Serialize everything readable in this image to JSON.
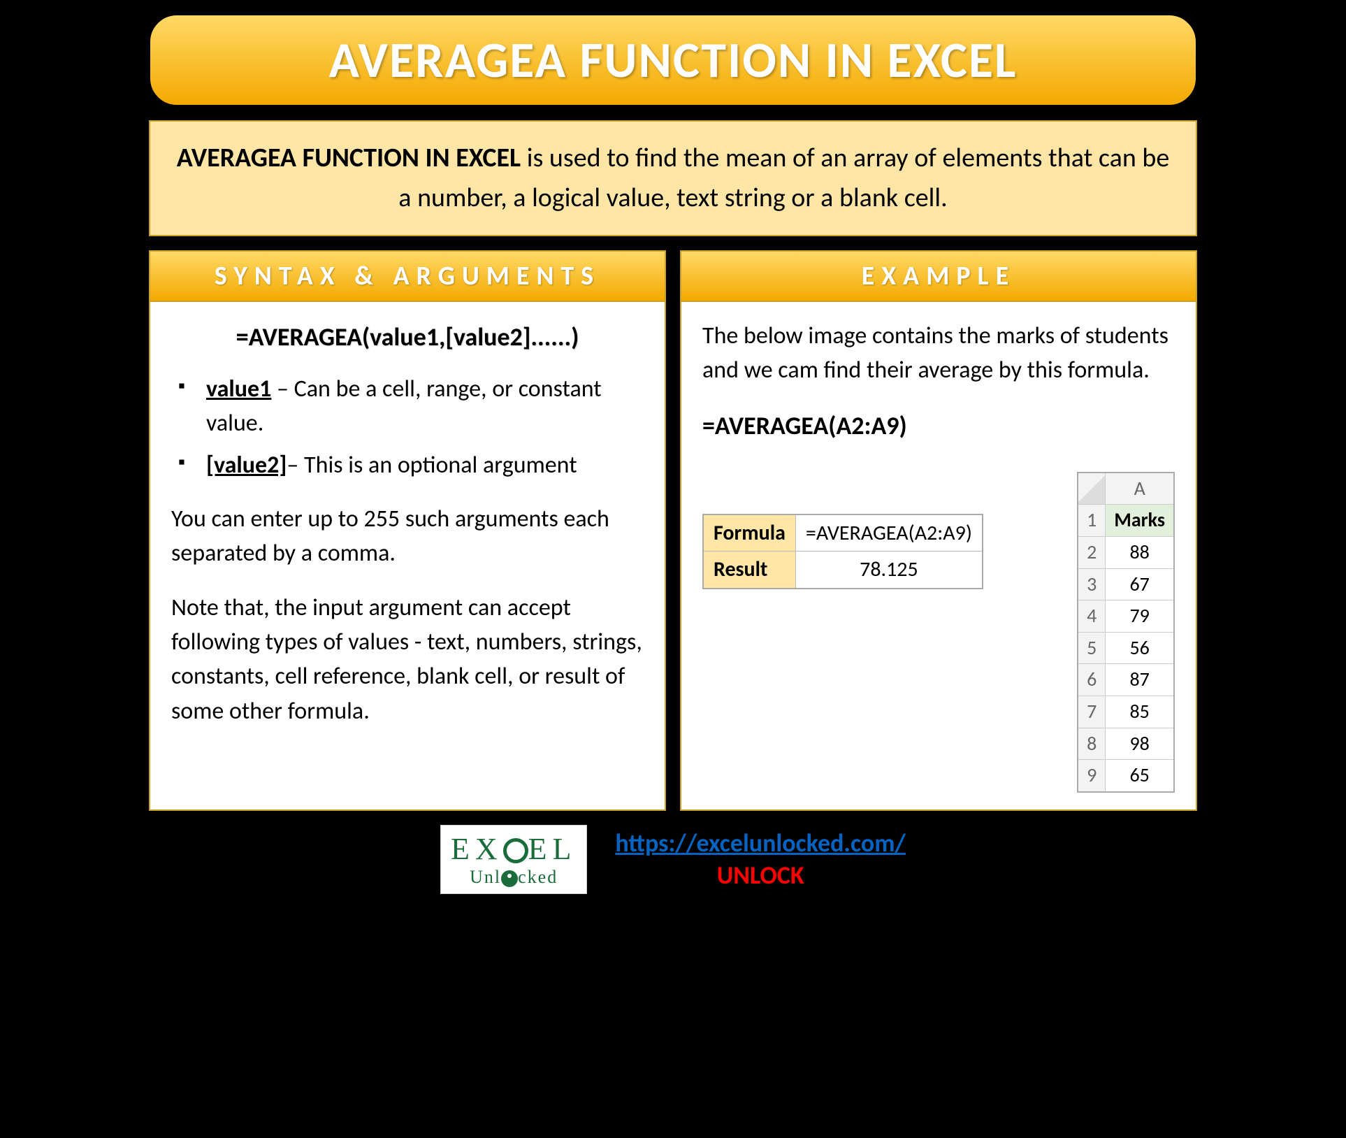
{
  "title": "AVERAGEA FUNCTION IN EXCEL",
  "description": {
    "lead": "AVERAGEA FUNCTION IN EXCEL",
    "rest": " is used to find the mean of an array of elements that can be a number, a logical value, text string or a blank cell."
  },
  "syntax": {
    "header": "SYNTAX & ARGUMENTS",
    "formula": "=AVERAGEA(value1,[value2]......)",
    "args": [
      {
        "name": "value1",
        "desc": " – Can be a cell, range, or constant value."
      },
      {
        "name": "[value2]",
        "desc": "– This is an optional argument"
      }
    ],
    "para1": "You can enter up to 255 such arguments each separated by a comma.",
    "para2": "Note that, the input argument can accept following types of values - text, numbers, strings, constants, cell reference, blank cell, or result of some other formula."
  },
  "example": {
    "header": "EXAMPLE",
    "intro": "The below image contains the marks of students and we cam find their average by this formula.",
    "formula": "=AVERAGEA(A2:A9)",
    "result_table": {
      "formula_label": "Formula",
      "formula_value": "=AVERAGEA(A2:A9)",
      "result_label": "Result",
      "result_value": "78.125"
    },
    "sheet": {
      "col": "A",
      "header": "Marks",
      "rows": [
        {
          "n": "1",
          "v": "Marks"
        },
        {
          "n": "2",
          "v": "88"
        },
        {
          "n": "3",
          "v": "67"
        },
        {
          "n": "4",
          "v": "79"
        },
        {
          "n": "5",
          "v": "56"
        },
        {
          "n": "6",
          "v": "87"
        },
        {
          "n": "7",
          "v": "85"
        },
        {
          "n": "8",
          "v": "98"
        },
        {
          "n": "9",
          "v": "65"
        }
      ]
    }
  },
  "footer": {
    "logo_top_1": "EX",
    "logo_top_2": "EL",
    "logo_bottom_1": "Unl",
    "logo_bottom_2": "cked",
    "url": "https://excelunlocked.com/",
    "unlock": "UNLOCK"
  }
}
